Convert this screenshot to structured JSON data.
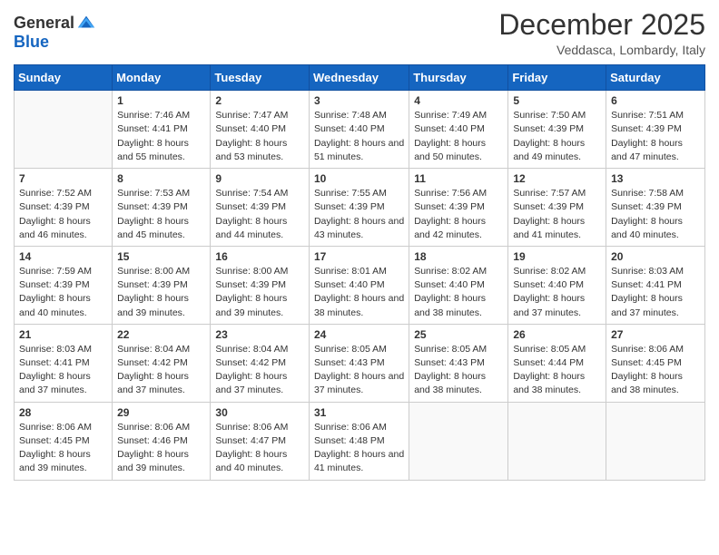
{
  "header": {
    "logo_general": "General",
    "logo_blue": "Blue",
    "month_title": "December 2025",
    "location": "Veddasca, Lombardy, Italy"
  },
  "weekdays": [
    "Sunday",
    "Monday",
    "Tuesday",
    "Wednesday",
    "Thursday",
    "Friday",
    "Saturday"
  ],
  "weeks": [
    [
      {
        "day": "",
        "empty": true
      },
      {
        "day": "1",
        "sunrise": "Sunrise: 7:46 AM",
        "sunset": "Sunset: 4:41 PM",
        "daylight": "Daylight: 8 hours and 55 minutes."
      },
      {
        "day": "2",
        "sunrise": "Sunrise: 7:47 AM",
        "sunset": "Sunset: 4:40 PM",
        "daylight": "Daylight: 8 hours and 53 minutes."
      },
      {
        "day": "3",
        "sunrise": "Sunrise: 7:48 AM",
        "sunset": "Sunset: 4:40 PM",
        "daylight": "Daylight: 8 hours and 51 minutes."
      },
      {
        "day": "4",
        "sunrise": "Sunrise: 7:49 AM",
        "sunset": "Sunset: 4:40 PM",
        "daylight": "Daylight: 8 hours and 50 minutes."
      },
      {
        "day": "5",
        "sunrise": "Sunrise: 7:50 AM",
        "sunset": "Sunset: 4:39 PM",
        "daylight": "Daylight: 8 hours and 49 minutes."
      },
      {
        "day": "6",
        "sunrise": "Sunrise: 7:51 AM",
        "sunset": "Sunset: 4:39 PM",
        "daylight": "Daylight: 8 hours and 47 minutes."
      }
    ],
    [
      {
        "day": "7",
        "sunrise": "Sunrise: 7:52 AM",
        "sunset": "Sunset: 4:39 PM",
        "daylight": "Daylight: 8 hours and 46 minutes."
      },
      {
        "day": "8",
        "sunrise": "Sunrise: 7:53 AM",
        "sunset": "Sunset: 4:39 PM",
        "daylight": "Daylight: 8 hours and 45 minutes."
      },
      {
        "day": "9",
        "sunrise": "Sunrise: 7:54 AM",
        "sunset": "Sunset: 4:39 PM",
        "daylight": "Daylight: 8 hours and 44 minutes."
      },
      {
        "day": "10",
        "sunrise": "Sunrise: 7:55 AM",
        "sunset": "Sunset: 4:39 PM",
        "daylight": "Daylight: 8 hours and 43 minutes."
      },
      {
        "day": "11",
        "sunrise": "Sunrise: 7:56 AM",
        "sunset": "Sunset: 4:39 PM",
        "daylight": "Daylight: 8 hours and 42 minutes."
      },
      {
        "day": "12",
        "sunrise": "Sunrise: 7:57 AM",
        "sunset": "Sunset: 4:39 PM",
        "daylight": "Daylight: 8 hours and 41 minutes."
      },
      {
        "day": "13",
        "sunrise": "Sunrise: 7:58 AM",
        "sunset": "Sunset: 4:39 PM",
        "daylight": "Daylight: 8 hours and 40 minutes."
      }
    ],
    [
      {
        "day": "14",
        "sunrise": "Sunrise: 7:59 AM",
        "sunset": "Sunset: 4:39 PM",
        "daylight": "Daylight: 8 hours and 40 minutes."
      },
      {
        "day": "15",
        "sunrise": "Sunrise: 8:00 AM",
        "sunset": "Sunset: 4:39 PM",
        "daylight": "Daylight: 8 hours and 39 minutes."
      },
      {
        "day": "16",
        "sunrise": "Sunrise: 8:00 AM",
        "sunset": "Sunset: 4:39 PM",
        "daylight": "Daylight: 8 hours and 39 minutes."
      },
      {
        "day": "17",
        "sunrise": "Sunrise: 8:01 AM",
        "sunset": "Sunset: 4:40 PM",
        "daylight": "Daylight: 8 hours and 38 minutes."
      },
      {
        "day": "18",
        "sunrise": "Sunrise: 8:02 AM",
        "sunset": "Sunset: 4:40 PM",
        "daylight": "Daylight: 8 hours and 38 minutes."
      },
      {
        "day": "19",
        "sunrise": "Sunrise: 8:02 AM",
        "sunset": "Sunset: 4:40 PM",
        "daylight": "Daylight: 8 hours and 37 minutes."
      },
      {
        "day": "20",
        "sunrise": "Sunrise: 8:03 AM",
        "sunset": "Sunset: 4:41 PM",
        "daylight": "Daylight: 8 hours and 37 minutes."
      }
    ],
    [
      {
        "day": "21",
        "sunrise": "Sunrise: 8:03 AM",
        "sunset": "Sunset: 4:41 PM",
        "daylight": "Daylight: 8 hours and 37 minutes."
      },
      {
        "day": "22",
        "sunrise": "Sunrise: 8:04 AM",
        "sunset": "Sunset: 4:42 PM",
        "daylight": "Daylight: 8 hours and 37 minutes."
      },
      {
        "day": "23",
        "sunrise": "Sunrise: 8:04 AM",
        "sunset": "Sunset: 4:42 PM",
        "daylight": "Daylight: 8 hours and 37 minutes."
      },
      {
        "day": "24",
        "sunrise": "Sunrise: 8:05 AM",
        "sunset": "Sunset: 4:43 PM",
        "daylight": "Daylight: 8 hours and 37 minutes."
      },
      {
        "day": "25",
        "sunrise": "Sunrise: 8:05 AM",
        "sunset": "Sunset: 4:43 PM",
        "daylight": "Daylight: 8 hours and 38 minutes."
      },
      {
        "day": "26",
        "sunrise": "Sunrise: 8:05 AM",
        "sunset": "Sunset: 4:44 PM",
        "daylight": "Daylight: 8 hours and 38 minutes."
      },
      {
        "day": "27",
        "sunrise": "Sunrise: 8:06 AM",
        "sunset": "Sunset: 4:45 PM",
        "daylight": "Daylight: 8 hours and 38 minutes."
      }
    ],
    [
      {
        "day": "28",
        "sunrise": "Sunrise: 8:06 AM",
        "sunset": "Sunset: 4:45 PM",
        "daylight": "Daylight: 8 hours and 39 minutes."
      },
      {
        "day": "29",
        "sunrise": "Sunrise: 8:06 AM",
        "sunset": "Sunset: 4:46 PM",
        "daylight": "Daylight: 8 hours and 39 minutes."
      },
      {
        "day": "30",
        "sunrise": "Sunrise: 8:06 AM",
        "sunset": "Sunset: 4:47 PM",
        "daylight": "Daylight: 8 hours and 40 minutes."
      },
      {
        "day": "31",
        "sunrise": "Sunrise: 8:06 AM",
        "sunset": "Sunset: 4:48 PM",
        "daylight": "Daylight: 8 hours and 41 minutes."
      },
      {
        "day": "",
        "empty": true
      },
      {
        "day": "",
        "empty": true
      },
      {
        "day": "",
        "empty": true
      }
    ]
  ]
}
